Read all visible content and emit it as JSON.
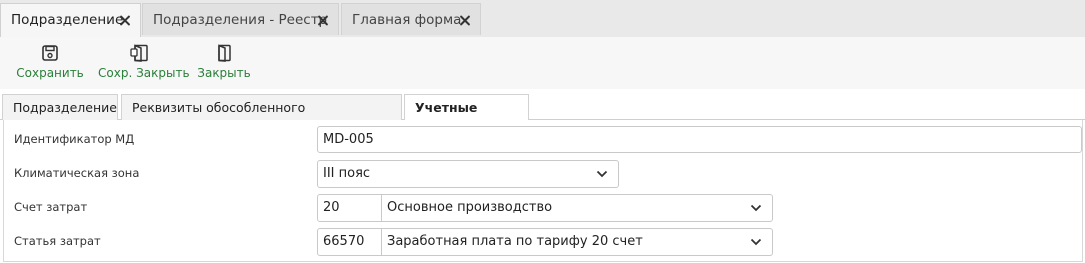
{
  "doc_tabs": [
    {
      "label": "Подразделение"
    },
    {
      "label": "Подразделения - Реестр"
    },
    {
      "label": "Главная форма"
    }
  ],
  "toolbar": {
    "save_label": "Сохранить",
    "save_close_label": "Сохр. Закрыть",
    "close_label": "Закрыть",
    "label_color": "#2a7f3a"
  },
  "section_tabs": [
    {
      "label": "Подразделение"
    },
    {
      "label": "Реквизиты обособленного подразделения"
    },
    {
      "label": "Учетные данные",
      "active": true
    }
  ],
  "form": {
    "md_id": {
      "label": "Идентификатор МД",
      "value": "MD-005"
    },
    "climate_zone": {
      "label": "Климатическая зона",
      "value": "III пояс"
    },
    "cost_account": {
      "label": "Счет затрат",
      "code": "20",
      "value": "Основное производство"
    },
    "cost_item": {
      "label": "Статья затрат",
      "code": "66570",
      "value": "Заработная плата по тарифу 20 счет"
    }
  }
}
